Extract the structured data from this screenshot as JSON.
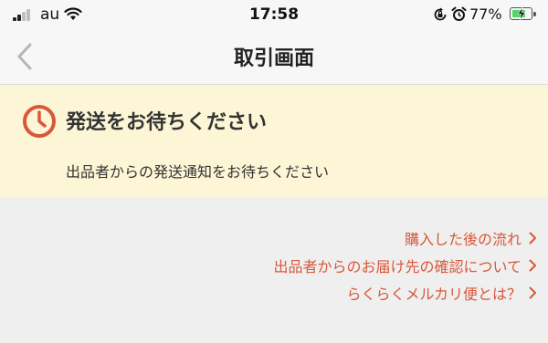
{
  "status_bar": {
    "carrier": "au",
    "time": "17:58",
    "battery_percent": "77%",
    "battery_level": 0.77,
    "icons": [
      "signal-icon",
      "wifi-icon",
      "rotation-lock-icon",
      "alarm-icon",
      "battery-charging-icon"
    ]
  },
  "nav": {
    "title": "取引画面",
    "back_icon": "chevron-left-icon"
  },
  "banner": {
    "icon": "clock-icon",
    "title": "発送をお待ちください",
    "subtitle": "出品者からの発送通知をお待ちください",
    "background": "#fdf6d6",
    "icon_color": "#d9573a"
  },
  "links": [
    {
      "label": "購入した後の流れ"
    },
    {
      "label": "出品者からのお届け先の確認について"
    },
    {
      "label": "らくらくメルカリ便とは？"
    }
  ],
  "colors": {
    "link": "#d9573a",
    "page_background": "#efefef"
  }
}
